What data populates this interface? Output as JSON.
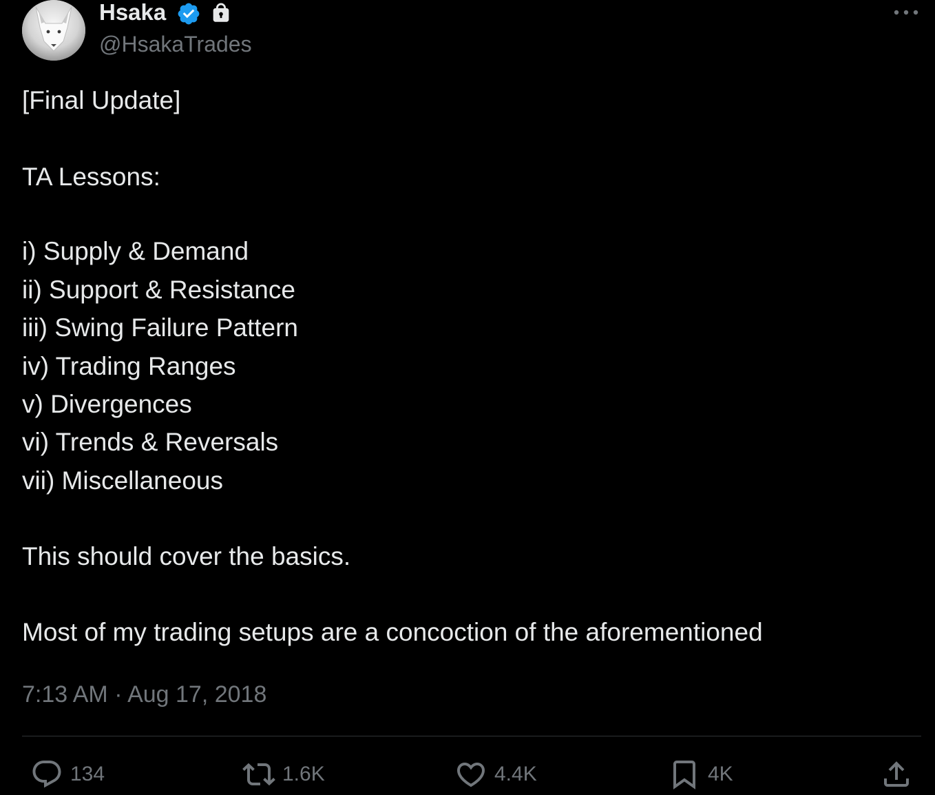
{
  "author": {
    "display_name": "Hsaka",
    "handle": "@HsakaTrades",
    "verified": true,
    "protected": true,
    "avatar": "white-fox-avatar"
  },
  "tweet": {
    "heading": "[Final Update]",
    "subheading": "TA Lessons:",
    "lessons": [
      "i) Supply & Demand",
      "ii) Support & Resistance",
      "iii) Swing Failure Pattern",
      "iv) Trading Ranges",
      "v) Divergences",
      "vi) Trends & Reversals",
      "vii) Miscellaneous"
    ],
    "paragraph_1": "This should cover the basics.",
    "paragraph_2": "Most of my trading setups are a concoction of the aforementioned",
    "timestamp": "7:13 AM · Aug 17, 2018"
  },
  "actions": {
    "replies": "134",
    "retweets": "1.6K",
    "likes": "4.4K",
    "bookmarks": "4K"
  },
  "icons": {
    "verified": "verified-badge-icon",
    "lock": "lock-icon",
    "more": "more-options-icon",
    "reply": "reply-icon",
    "retweet": "retweet-icon",
    "like": "heart-icon",
    "bookmark": "bookmark-icon",
    "share": "share-icon"
  },
  "colors": {
    "background": "#000000",
    "text_primary": "#e7e9ea",
    "text_secondary": "#71767b",
    "verified_blue": "#1d9bf0",
    "divider": "#2f3336"
  }
}
